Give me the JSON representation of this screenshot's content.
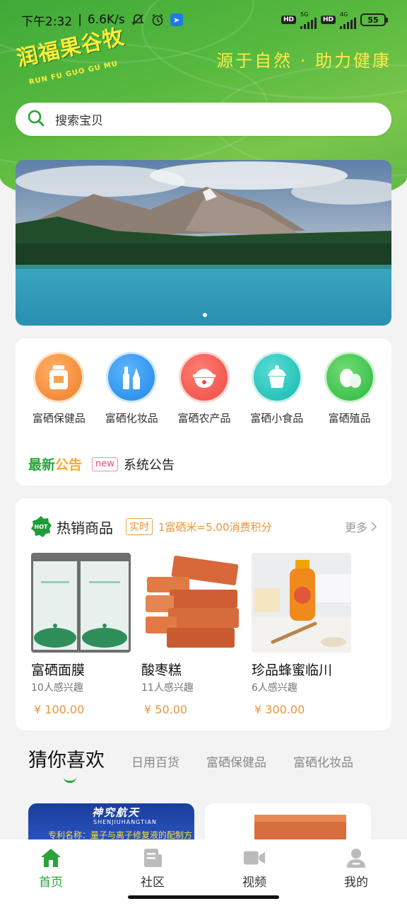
{
  "status_bar": {
    "time": "下午2:32",
    "speed": "6.6K/s",
    "hd1": "HD",
    "net1": "5G",
    "hd2": "HD",
    "net2": "4G",
    "battery": "55",
    "icons": [
      "mute-icon",
      "alarm-icon",
      "app-notification-icon",
      "signal-icon",
      "battery-icon"
    ]
  },
  "header": {
    "logo_text": "润福果谷牧",
    "logo_sub": "RUN FU GUO GU MU",
    "slogan": "源于自然 · 助力健康"
  },
  "search": {
    "placeholder": "搜索宝贝",
    "icon": "search-icon"
  },
  "categories": [
    {
      "label": "富硒保健品",
      "icon": "supplement-bottle-icon",
      "color": "#f07b2a"
    },
    {
      "label": "富硒化妆品",
      "icon": "cosmetics-icon",
      "color": "#1e87e5"
    },
    {
      "label": "富硒农产品",
      "icon": "rice-bowl-icon",
      "color": "#ee4a43"
    },
    {
      "label": "富硒小食品",
      "icon": "cake-icon",
      "color": "#18b9b0"
    },
    {
      "label": "富硒殖品",
      "icon": "eggs-icon",
      "color": "#2db83f"
    }
  ],
  "notice": {
    "title_part1": "最新",
    "title_part2": "公告",
    "badge": "new",
    "text": "系统公告"
  },
  "hot": {
    "badge": "HOT",
    "title": "热销商品",
    "realtime": "实时",
    "rate": "1富硒米=5.00消费积分",
    "more": "更多",
    "products": [
      {
        "name": "富硒面膜",
        "interest": "10人感兴趣",
        "price": "¥ 100.00"
      },
      {
        "name": "酸枣糕",
        "interest": "11人感兴趣",
        "price": "¥ 50.00"
      },
      {
        "name": "珍品蜂蜜临川",
        "interest": "6人感兴趣",
        "price": "¥ 300.00"
      }
    ]
  },
  "guess": {
    "title": "猜你喜欢",
    "tabs": [
      "日用百货",
      "富硒保健品",
      "富硒化妆品"
    ],
    "feed_left_title": "神究航天",
    "feed_left_sub": "SHENJIUHANGTIAN",
    "feed_left_caption": "专利名称：量子与离子修复液的配制方"
  },
  "bottom_nav": [
    {
      "label": "首页",
      "icon": "home-icon",
      "active": true
    },
    {
      "label": "社区",
      "icon": "community-icon",
      "active": false
    },
    {
      "label": "视频",
      "icon": "video-icon",
      "active": false
    },
    {
      "label": "我的",
      "icon": "profile-icon",
      "active": false
    }
  ],
  "colors": {
    "brand_green": "#2aa43a",
    "accent_orange": "#e7973b",
    "slogan_yellow": "#ffe94a"
  }
}
